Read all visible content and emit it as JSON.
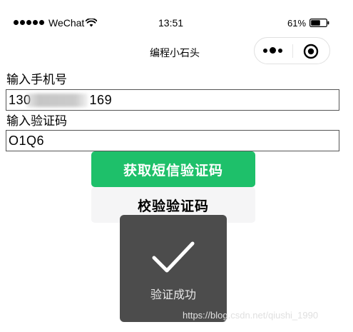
{
  "status_bar": {
    "carrier": "WeChat",
    "time": "13:51",
    "battery_percent": "61%",
    "battery_level": 0.61,
    "signal_icon": "signal-dots-icon",
    "wifi_icon": "wifi-icon",
    "battery_icon": "battery-icon"
  },
  "nav": {
    "title": "编程小石头",
    "more_icon": "more-dots-icon",
    "close_icon": "target-close-icon"
  },
  "form": {
    "phone_label": "输入手机号",
    "phone_value_prefix": "130",
    "phone_value_suffix": "169",
    "code_label": "输入验证码",
    "code_value": "O1Q6"
  },
  "buttons": {
    "get_code": "获取短信验证码",
    "verify_code": "校验验证码"
  },
  "toast": {
    "message": "验证成功",
    "icon": "checkmark-icon"
  },
  "watermark": "https://blog.csdn.net/qiushi_1990",
  "colors": {
    "primary_green": "#1ec06a",
    "toast_bg": "#4c4c4c",
    "secondary_button_bg": "#f5f5f6"
  }
}
